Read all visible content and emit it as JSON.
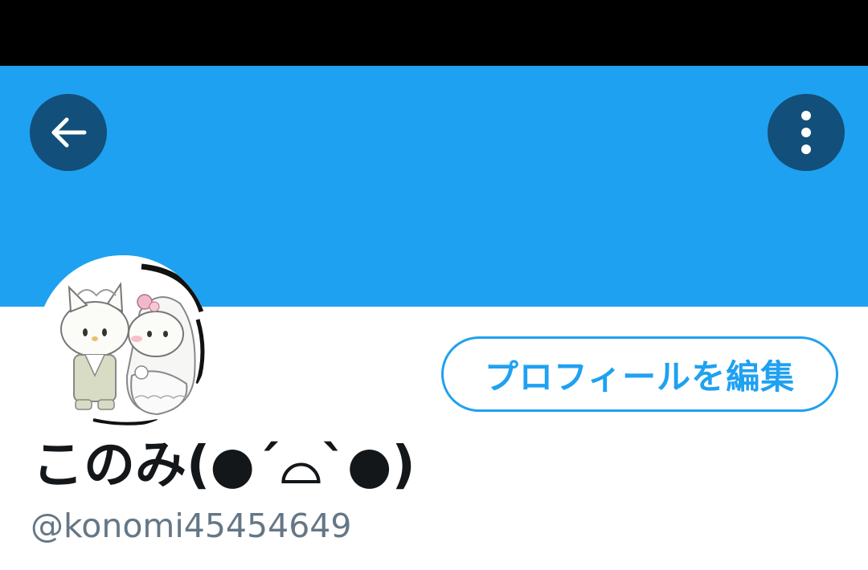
{
  "colors": {
    "status_bar": "#000000",
    "banner": "#1fa1f1",
    "header_button_bg": "#124f7a",
    "accent": "#1fa1f1",
    "name_text": "#14171a",
    "handle_text": "#657786"
  },
  "header": {
    "back_icon": "arrow-left-icon",
    "more_icon": "vertical-dots-icon"
  },
  "profile": {
    "avatar_description": "avatar",
    "edit_button_label": "プロフィールを編集",
    "display_name": "このみ(●´⌓`●)",
    "handle": "@konomi45454649"
  }
}
